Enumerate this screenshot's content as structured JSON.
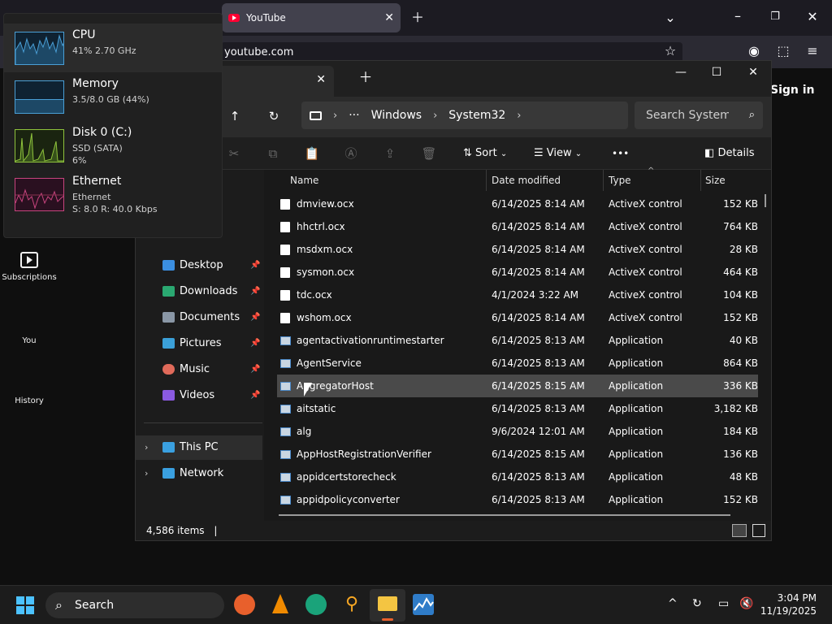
{
  "browser": {
    "tab_title": "YouTube",
    "url": "youtube.com",
    "sign_in": "Sign in",
    "sidebar": [
      {
        "label": "Subscriptions"
      },
      {
        "label": "You"
      },
      {
        "label": "History"
      }
    ]
  },
  "task_manager": {
    "items": [
      {
        "name": "CPU",
        "line1": "41% 2.70 GHz",
        "line2": "",
        "color": "#4a9fd6"
      },
      {
        "name": "Memory",
        "line1": "3.5/8.0 GB (44%)",
        "line2": "",
        "color": "#4a9fd6"
      },
      {
        "name": "Disk 0 (C:)",
        "line1": "SSD (SATA)",
        "line2": "6%",
        "color": "#8fc33c"
      },
      {
        "name": "Ethernet",
        "line1": "Ethernet",
        "line2": "S: 8.0 R: 40.0 Kbps",
        "color": "#c8447e"
      }
    ]
  },
  "explorer": {
    "breadcrumb": [
      "Windows",
      "System32"
    ],
    "search_placeholder": "Search System32",
    "cmd": {
      "sort": "Sort",
      "view": "View",
      "more": "•••",
      "details": "Details"
    },
    "sidebar": [
      {
        "label": "Desktop",
        "pinned": true,
        "color": "#3b8ee0"
      },
      {
        "label": "Downloads",
        "pinned": true,
        "color": "#2aa871"
      },
      {
        "label": "Documents",
        "pinned": true,
        "color": "#8a97a6"
      },
      {
        "label": "Pictures",
        "pinned": true,
        "color": "#3ba0d8"
      },
      {
        "label": "Music",
        "pinned": true,
        "color": "#e06a5a"
      },
      {
        "label": "Videos",
        "pinned": true,
        "color": "#8a5ae0"
      },
      {
        "label": "This PC",
        "pinned": false,
        "color": "#3aa0e0"
      },
      {
        "label": "Network",
        "pinned": false,
        "color": "#3aa0e0"
      }
    ],
    "columns": [
      "Name",
      "Date modified",
      "Type",
      "Size"
    ],
    "files": [
      {
        "name": "dmview.ocx",
        "date": "6/14/2025 8:14 AM",
        "type": "ActiveX control",
        "size": "152 KB",
        "kind": "doc"
      },
      {
        "name": "hhctrl.ocx",
        "date": "6/14/2025 8:14 AM",
        "type": "ActiveX control",
        "size": "764 KB",
        "kind": "doc"
      },
      {
        "name": "msdxm.ocx",
        "date": "6/14/2025 8:14 AM",
        "type": "ActiveX control",
        "size": "28 KB",
        "kind": "doc"
      },
      {
        "name": "sysmon.ocx",
        "date": "6/14/2025 8:14 AM",
        "type": "ActiveX control",
        "size": "464 KB",
        "kind": "doc"
      },
      {
        "name": "tdc.ocx",
        "date": "4/1/2024 3:22 AM",
        "type": "ActiveX control",
        "size": "104 KB",
        "kind": "doc"
      },
      {
        "name": "wshom.ocx",
        "date": "6/14/2025 8:14 AM",
        "type": "ActiveX control",
        "size": "152 KB",
        "kind": "doc"
      },
      {
        "name": "agentactivationruntimestarter",
        "date": "6/14/2025 8:13 AM",
        "type": "Application",
        "size": "40 KB",
        "kind": "app"
      },
      {
        "name": "AgentService",
        "date": "6/14/2025 8:13 AM",
        "type": "Application",
        "size": "864 KB",
        "kind": "app"
      },
      {
        "name": "AggregatorHost",
        "date": "6/14/2025 8:15 AM",
        "type": "Application",
        "size": "336 KB",
        "kind": "app",
        "selected": true
      },
      {
        "name": "aitstatic",
        "date": "6/14/2025 8:13 AM",
        "type": "Application",
        "size": "3,182 KB",
        "kind": "app"
      },
      {
        "name": "alg",
        "date": "9/6/2024 12:01 AM",
        "type": "Application",
        "size": "184 KB",
        "kind": "app"
      },
      {
        "name": "AppHostRegistrationVerifier",
        "date": "6/14/2025 8:15 AM",
        "type": "Application",
        "size": "136 KB",
        "kind": "app"
      },
      {
        "name": "appidcertstorecheck",
        "date": "6/14/2025 8:13 AM",
        "type": "Application",
        "size": "48 KB",
        "kind": "app"
      },
      {
        "name": "appidpolicyconverter",
        "date": "6/14/2025 8:13 AM",
        "type": "Application",
        "size": "152 KB",
        "kind": "app"
      }
    ],
    "status": "4,586 items"
  },
  "taskbar": {
    "search": "Search",
    "time": "3:04 PM",
    "date": "11/19/2025"
  }
}
